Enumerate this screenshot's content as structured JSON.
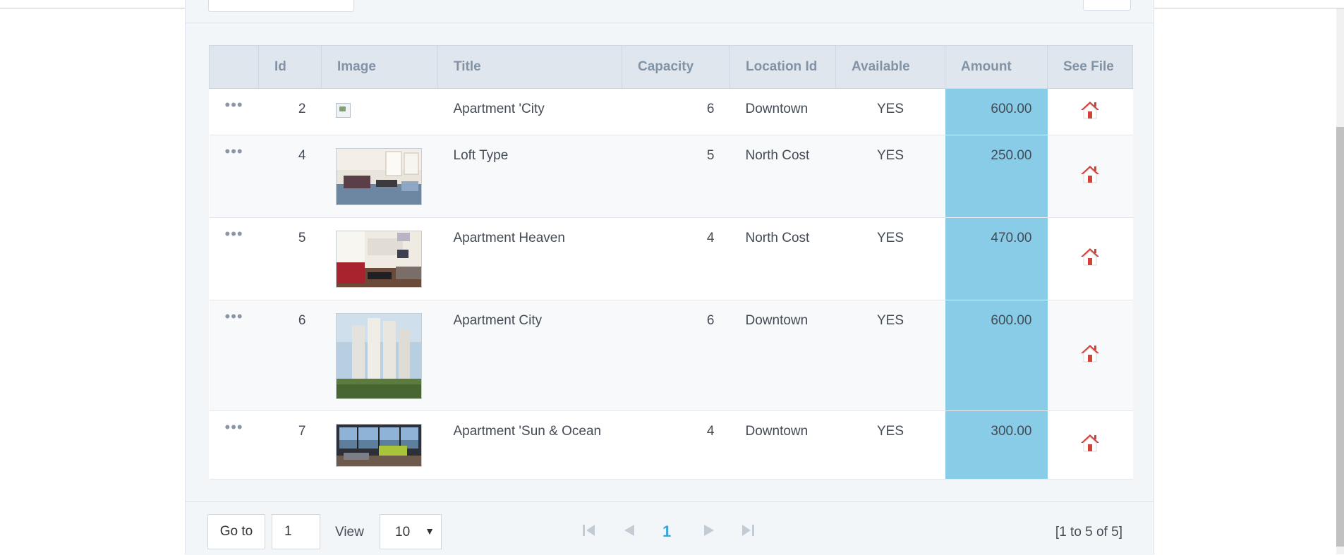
{
  "table": {
    "headers": {
      "actions": "",
      "id": "Id",
      "image": "Image",
      "title": "Title",
      "capacity": "Capacity",
      "location": "Location Id",
      "available": "Available",
      "amount": "Amount",
      "file": "See File"
    },
    "rows": [
      {
        "id": "2",
        "title": "Apartment 'City",
        "capacity": "6",
        "location": "Downtown",
        "available": "YES",
        "amount": "600.00"
      },
      {
        "id": "4",
        "title": "Loft Type",
        "capacity": "5",
        "location": "North Cost",
        "available": "YES",
        "amount": "250.00"
      },
      {
        "id": "5",
        "title": "Apartment Heaven",
        "capacity": "4",
        "location": "North Cost",
        "available": "YES",
        "amount": "470.00"
      },
      {
        "id": "6",
        "title": "Apartment City",
        "capacity": "6",
        "location": "Downtown",
        "available": "YES",
        "amount": "600.00"
      },
      {
        "id": "7",
        "title": "Apartment 'Sun & Ocean",
        "capacity": "4",
        "location": "Downtown",
        "available": "YES",
        "amount": "300.00"
      }
    ],
    "row_actions_glyph": "•••",
    "amount_highlight_color": "#88cce8",
    "file_icon": "house-icon"
  },
  "footer": {
    "goto_label": "Go to",
    "goto_value": "1",
    "view_label": "View",
    "view_value": "10",
    "current_page": "1",
    "range_text": "[1 to 5 of 5]"
  },
  "colors": {
    "header_bg": "#dfe6ee",
    "header_text": "#8293a6",
    "page_active": "#3aa3d9",
    "house_roof": "#d2423a"
  }
}
